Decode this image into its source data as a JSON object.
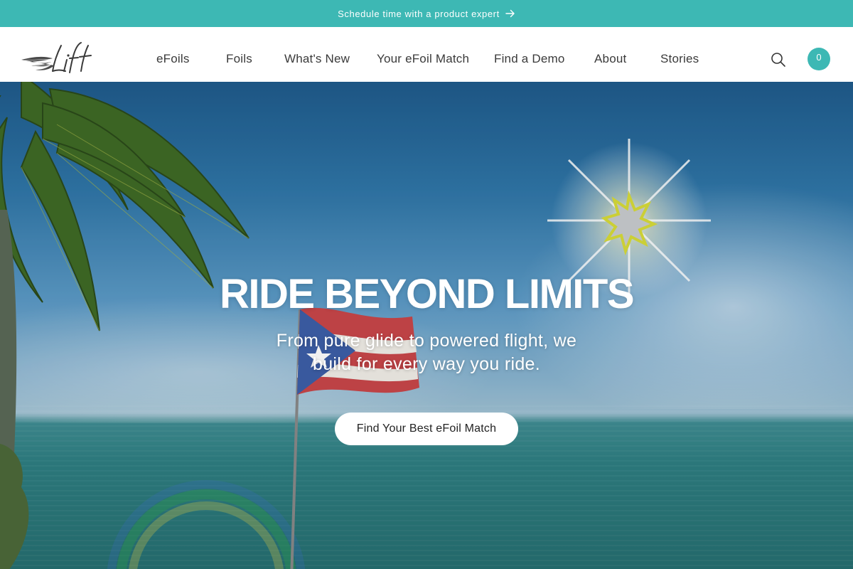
{
  "announcement": {
    "text": "Schedule time with a product expert",
    "arrow_icon": "arrow-right-icon"
  },
  "brand": {
    "logo_text": "Lift",
    "accent_color": "#3db8b4"
  },
  "nav": {
    "items": [
      {
        "label": "eFoils"
      },
      {
        "label": "Foils"
      },
      {
        "label": "What's New"
      },
      {
        "label": "Your eFoil Match"
      },
      {
        "label": "Find a Demo"
      },
      {
        "label": "About"
      },
      {
        "label": "Stories"
      }
    ],
    "search_icon": "search-icon",
    "cart_count": "0"
  },
  "hero": {
    "title": "RIDE BEYOND LIMITS",
    "subtitle": "From pure glide to powered flight, we build for every way you ride.",
    "cta_label": "Find Your Best eFoil Match"
  }
}
